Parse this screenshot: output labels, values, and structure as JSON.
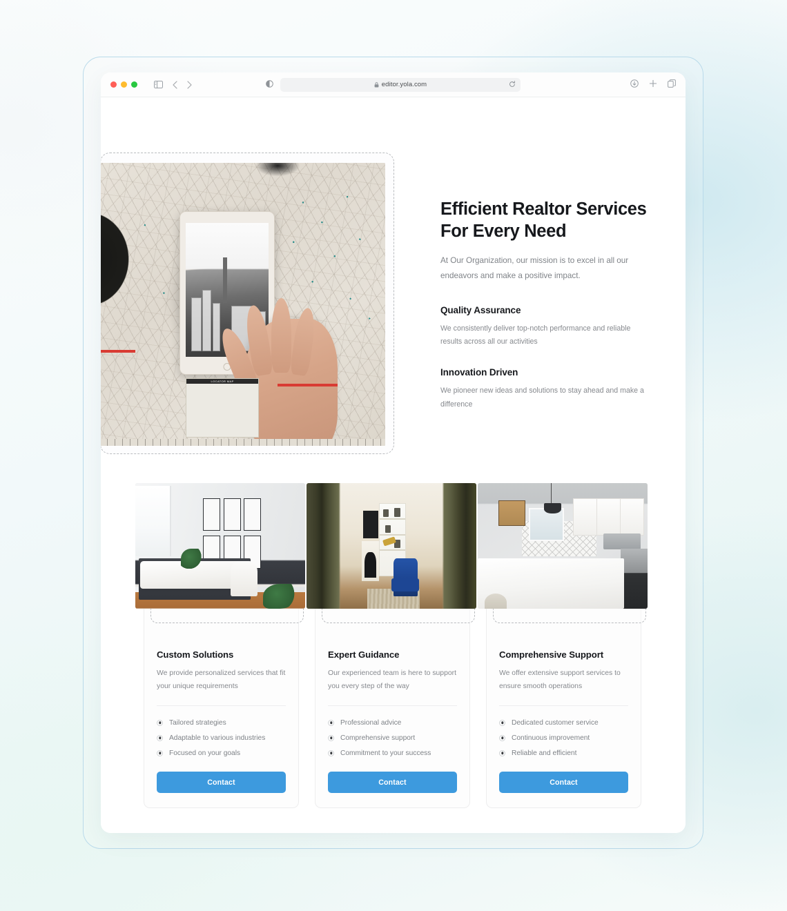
{
  "browser": {
    "url": "editor.yola.com",
    "lock_icon": "lock-icon",
    "reload_icon": "reload-icon",
    "back_icon": "chevron-left-icon",
    "forward_icon": "chevron-right-icon",
    "sidebar_icon": "sidebar-toggle-icon",
    "reader_icon": "reader-view-icon",
    "download_icon": "download-icon",
    "new_tab_icon": "plus-icon",
    "tab_overview_icon": "tab-overview-icon",
    "traffic_lights": [
      "close",
      "minimize",
      "zoom"
    ]
  },
  "hero": {
    "image_alt": "tablet on paper map with hand",
    "title": "Efficient Realtor Services For Every Need",
    "subtitle": "At Our Organization, our mission is to excel in all our endeavors and make a positive impact.",
    "features": [
      {
        "title": "Quality Assurance",
        "text": "We consistently deliver top-notch performance and reliable results across all our activities"
      },
      {
        "title": "Innovation Driven",
        "text": "We pioneer new ideas and solutions to stay ahead and make a difference"
      }
    ]
  },
  "cards": [
    {
      "image_alt": "bedroom with framed art",
      "title": "Custom Solutions",
      "description": "We provide personalized services that fit your unique requirements",
      "items": [
        "Tailored strategies",
        "Adaptable to various industries",
        "Focused on your goals"
      ],
      "button": "Contact"
    },
    {
      "image_alt": "living room with blue armchair",
      "title": "Expert Guidance",
      "description": "Our experienced team is here to support you every step of the way",
      "items": [
        "Professional advice",
        "Comprehensive support",
        "Commitment to your success"
      ],
      "button": "Contact"
    },
    {
      "image_alt": "white kitchen with island",
      "title": "Comprehensive Support",
      "description": "We offer extensive support services to ensure smooth operations",
      "items": [
        "Dedicated customer service",
        "Continuous improvement",
        "Reliable and efficient"
      ],
      "button": "Contact"
    }
  ],
  "colors": {
    "accent": "#3d9ade",
    "heading": "#16181c",
    "body_text": "#86898e",
    "frame_border": "#b9daea",
    "selection_dash": "#b9bcbf"
  }
}
